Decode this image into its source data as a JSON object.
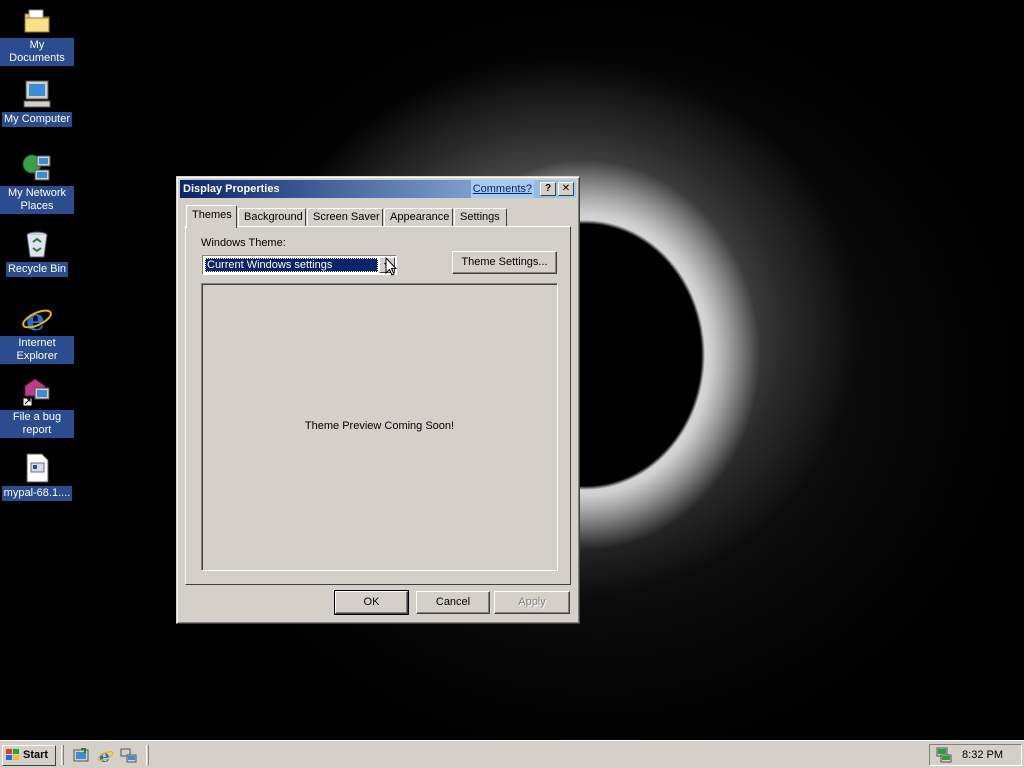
{
  "desktop": {
    "icons": [
      {
        "label": "My Documents",
        "icon": "my-documents-icon"
      },
      {
        "label": "My Computer",
        "icon": "my-computer-icon"
      },
      {
        "label": "My Network Places",
        "icon": "network-places-icon"
      },
      {
        "label": "Recycle Bin",
        "icon": "recycle-bin-icon"
      },
      {
        "label": "Internet Explorer",
        "icon": "internet-explorer-icon"
      },
      {
        "label": "File a bug report",
        "icon": "bug-report-icon"
      },
      {
        "label": "mypal-68.1....",
        "icon": "file-icon"
      }
    ]
  },
  "dialog": {
    "title": "Display Properties",
    "comments_link": "Comments?",
    "help_button": "?",
    "close_button": "✕",
    "tabs": [
      "Themes",
      "Background",
      "Screen Saver",
      "Appearance",
      "Settings"
    ],
    "active_tab": "Themes",
    "windows_theme_label": "Windows Theme:",
    "theme_select_value": "Current Windows settings",
    "theme_settings_button": "Theme Settings...",
    "preview_message": "Theme Preview Coming Soon!",
    "ok_button": "OK",
    "cancel_button": "Cancel",
    "apply_button": "Apply"
  },
  "taskbar": {
    "start_label": "Start",
    "quick_launch": [
      "show-desktop-icon",
      "internet-explorer-icon",
      "network-icon"
    ],
    "clock": "8:32 PM"
  }
}
